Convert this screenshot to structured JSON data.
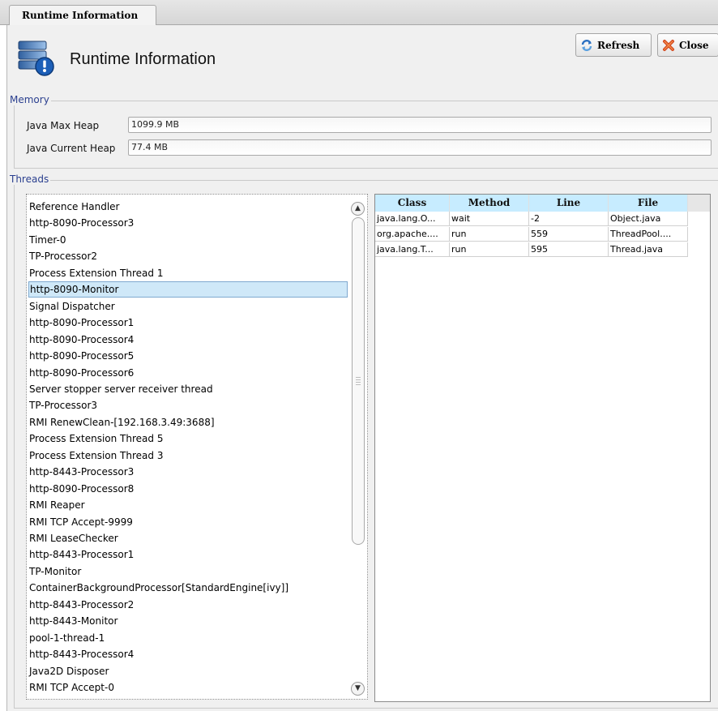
{
  "tab": {
    "label": "Runtime Information"
  },
  "header": {
    "title": "Runtime Information",
    "icon": "server-info-icon"
  },
  "toolbar": {
    "refresh_label": "Refresh",
    "close_label": "Close",
    "refresh_icon": "refresh-icon",
    "close_icon": "close-icon"
  },
  "memory": {
    "legend": "Memory",
    "max_heap_label": "Java Max Heap",
    "max_heap_value": "1099.9 MB",
    "current_heap_label": "Java Current Heap",
    "current_heap_value": "77.4 MB"
  },
  "threads": {
    "legend": "Threads",
    "selected": "http-8090-Monitor",
    "items": [
      "Reference Handler",
      "http-8090-Processor3",
      "Timer-0",
      "TP-Processor2",
      "Process Extension Thread 1",
      "http-8090-Monitor",
      "Signal Dispatcher",
      "http-8090-Processor1",
      "http-8090-Processor4",
      "http-8090-Processor5",
      "http-8090-Processor6",
      "Server stopper server receiver thread",
      "TP-Processor3",
      "RMI RenewClean-[192.168.3.49:3688]",
      "Process Extension Thread 5",
      "Process Extension Thread 3",
      "http-8443-Processor3",
      "http-8090-Processor8",
      "RMI Reaper",
      "RMI TCP Accept-9999",
      "RMI LeaseChecker",
      "http-8443-Processor1",
      "TP-Monitor",
      "ContainerBackgroundProcessor[StandardEngine[ivy]]",
      "http-8443-Processor2",
      "http-8443-Monitor",
      "pool-1-thread-1",
      "http-8443-Processor4",
      "Java2D Disposer",
      "RMI TCP Accept-0"
    ]
  },
  "stack": {
    "columns": [
      "Class",
      "Method",
      "Line",
      "File"
    ],
    "rows": [
      [
        "java.lang.O...",
        "wait",
        "-2",
        "Object.java"
      ],
      [
        "org.apache....",
        "run",
        "559",
        "ThreadPool...."
      ],
      [
        "java.lang.T...",
        "run",
        "595",
        "Thread.java"
      ]
    ]
  },
  "colors": {
    "header_bg": "#c7ecff",
    "selection_bg": "#cfe8f8",
    "legend_text": "#2a3f8f"
  }
}
